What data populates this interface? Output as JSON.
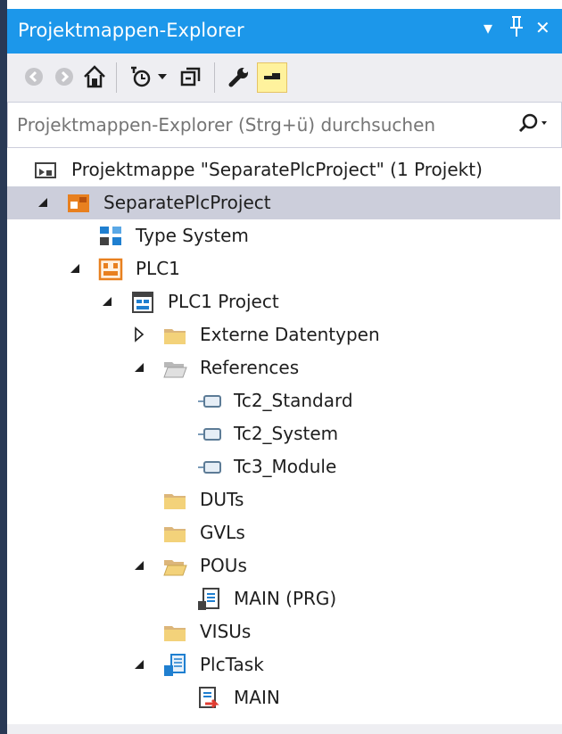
{
  "panel": {
    "title": "Projektmappen-Explorer",
    "controls": [
      "▾",
      "⊥",
      "✕"
    ]
  },
  "toolbar": {
    "buttons": [
      "back-icon",
      "forward-icon",
      "home-icon",
      "pending-changes-icon",
      "dropdown-icon",
      "collapse-all-icon",
      "properties-icon",
      "preview-icon"
    ]
  },
  "search": {
    "placeholder": "Projektmappen-Explorer (Strg+ü) durchsuchen"
  },
  "tree": {
    "items": [
      {
        "label": "Projektmappe \"SeparatePlcProject\" (1 Projekt)",
        "icon": "solution-icon"
      },
      {
        "label": "SeparatePlcProject",
        "icon": "twincat-project-icon",
        "expanded": true,
        "selected": true
      },
      {
        "label": "Type System",
        "icon": "type-system-icon"
      },
      {
        "label": "PLC1",
        "icon": "plc-icon",
        "expanded": true
      },
      {
        "label": "PLC1 Project",
        "icon": "plc-project-icon",
        "expanded": true
      },
      {
        "label": "Externe Datentypen",
        "icon": "folder-icon",
        "expanded": false
      },
      {
        "label": "References",
        "icon": "folder-open-icon",
        "expanded": true
      },
      {
        "label": "Tc2_Standard",
        "icon": "library-reference-icon"
      },
      {
        "label": "Tc2_System",
        "icon": "library-reference-icon"
      },
      {
        "label": "Tc3_Module",
        "icon": "library-reference-icon"
      },
      {
        "label": "DUTs",
        "icon": "folder-icon"
      },
      {
        "label": "GVLs",
        "icon": "folder-icon"
      },
      {
        "label": "POUs",
        "icon": "folder-open-icon",
        "expanded": true
      },
      {
        "label": "MAIN (PRG)",
        "icon": "program-icon"
      },
      {
        "label": "VISUs",
        "icon": "folder-icon"
      },
      {
        "label": "PlcTask",
        "icon": "task-icon",
        "expanded": true
      },
      {
        "label": "MAIN",
        "icon": "task-call-icon"
      }
    ]
  },
  "colors": {
    "title_bar": "#1c97ea",
    "selection": "#cccedb",
    "folder": "#dcb67a",
    "orange": "#e8801f"
  }
}
